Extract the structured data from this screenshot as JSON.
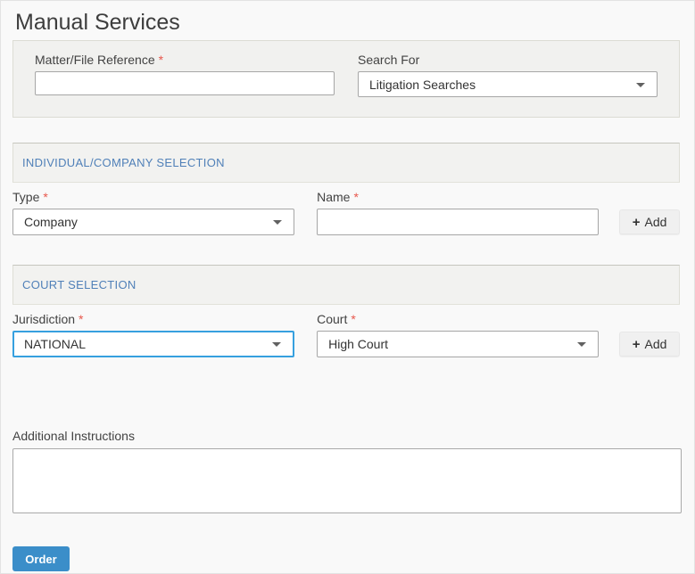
{
  "page": {
    "title": "Manual Services"
  },
  "required_marker": "*",
  "icons": {
    "add": "+",
    "dropdown_caret": "chevron-down"
  },
  "top_form": {
    "matter_ref": {
      "label": "Matter/File Reference",
      "required": true,
      "value": ""
    },
    "search_for": {
      "label": "Search For",
      "required": false,
      "value": "Litigation Searches"
    }
  },
  "individual_company": {
    "heading": "INDIVIDUAL/COMPANY SELECTION",
    "type": {
      "label": "Type",
      "required": true,
      "value": "Company"
    },
    "name": {
      "label": "Name",
      "required": true,
      "value": ""
    },
    "add_label": "Add"
  },
  "court_selection": {
    "heading": "COURT SELECTION",
    "jurisdiction": {
      "label": "Jurisdiction",
      "required": true,
      "value": "NATIONAL"
    },
    "court": {
      "label": "Court",
      "required": true,
      "value": "High Court"
    },
    "add_label": "Add"
  },
  "additional_instructions": {
    "label": "Additional Instructions",
    "value": ""
  },
  "order_button": {
    "label": "Order"
  },
  "colors": {
    "order_button_blue": "#3b8ec9",
    "section_heading_blue": "#5080b8",
    "required_red": "#e8574c",
    "focused_select_border": "#36a0df",
    "panel_gray": "#f1f1ef",
    "page_background": "#f9f9f9"
  }
}
